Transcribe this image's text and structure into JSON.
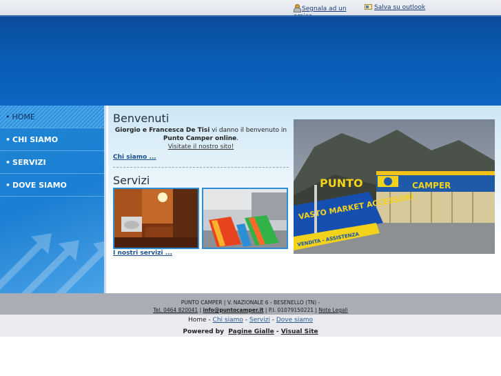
{
  "top_links": {
    "report": "Segnala ad un amico",
    "outlook": "Salva su outlook"
  },
  "nav": {
    "items": [
      {
        "label": "HOME"
      },
      {
        "label": "CHI SIAMO"
      },
      {
        "label": "SERVIZI"
      },
      {
        "label": "DOVE SIAMO"
      }
    ]
  },
  "welcome": {
    "title": "Benvenuti",
    "names": "Giorgio e Francesca De Tisi",
    "text1": " vi danno il benvenuto in ",
    "brand": "Punto Camper online",
    "text2": ".",
    "visit": "Visitate il nostro sito!",
    "more": "Chi siamo ..."
  },
  "services": {
    "title": "Servizi",
    "more": "I nostri servizi ..."
  },
  "photo": {
    "sign_punto": "PUNTO",
    "sign_camper": "CAMPER",
    "banner_text": "VASTO MARKET ACCESSORI",
    "sub_text": "VENDITA - ASSISTENZA"
  },
  "footer": {
    "line1": "PUNTO CAMPER | V. NAZIONALE 6 - BESENELLO (TN) -",
    "tel": "Tel. 0464 820041",
    "sep1": " | ",
    "email": "info@puntocamper.it",
    "piva": " | P.I. 01079150221 | ",
    "legal": "Note Legali",
    "nav": {
      "home": "Home",
      "chi": "Chi siamo",
      "servizi": "Servizi",
      "dove": "Dove siamo",
      "sep": " - "
    },
    "powered_label": "Powered by",
    "pagine": "Pagine Gialle",
    "dash": " - ",
    "visual": "Visual Site"
  }
}
